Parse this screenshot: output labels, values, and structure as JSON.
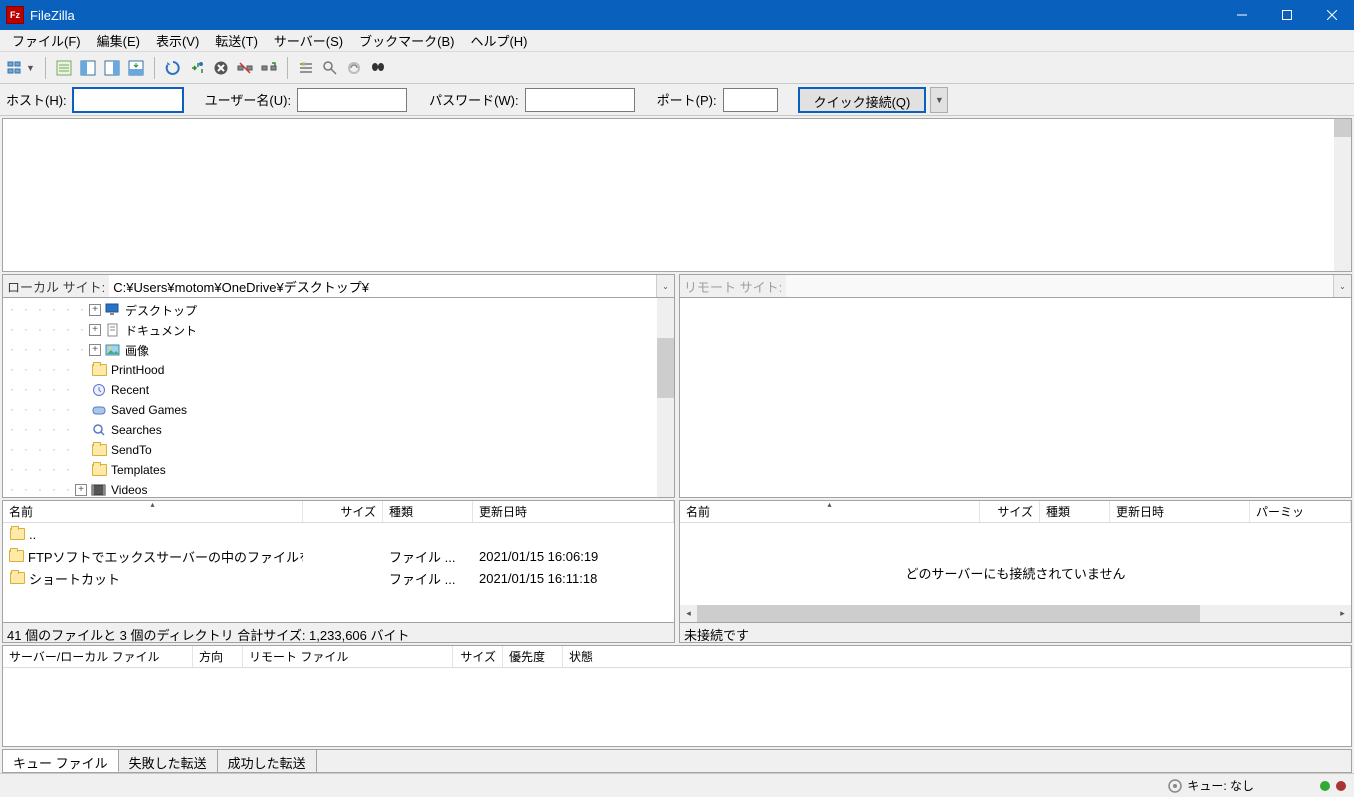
{
  "app": {
    "title": "FileZilla"
  },
  "menu": [
    "ファイル(F)",
    "編集(E)",
    "表示(V)",
    "転送(T)",
    "サーバー(S)",
    "ブックマーク(B)",
    "ヘルプ(H)"
  ],
  "quick": {
    "host_label": "ホスト(H):",
    "user_label": "ユーザー名(U):",
    "pass_label": "パスワード(W):",
    "port_label": "ポート(P):",
    "connect_btn": "クイック接続(Q)",
    "host": "",
    "user": "",
    "pass": "",
    "port": ""
  },
  "local": {
    "site_label": "ローカル サイト:",
    "path": "C:¥Users¥motom¥OneDrive¥デスクトップ¥",
    "tree": [
      {
        "indent": 6,
        "exp": "+",
        "icon": "desktop",
        "label": "デスクトップ"
      },
      {
        "indent": 6,
        "exp": "+",
        "icon": "document",
        "label": "ドキュメント"
      },
      {
        "indent": 6,
        "exp": "+",
        "icon": "picture",
        "label": "画像"
      },
      {
        "indent": 5,
        "exp": "",
        "icon": "folder",
        "label": "PrintHood"
      },
      {
        "indent": 5,
        "exp": "",
        "icon": "recent",
        "label": "Recent"
      },
      {
        "indent": 5,
        "exp": "",
        "icon": "games",
        "label": "Saved Games"
      },
      {
        "indent": 5,
        "exp": "",
        "icon": "search",
        "label": "Searches"
      },
      {
        "indent": 5,
        "exp": "",
        "icon": "folder",
        "label": "SendTo"
      },
      {
        "indent": 5,
        "exp": "",
        "icon": "folder",
        "label": "Templates"
      },
      {
        "indent": 5,
        "exp": "+",
        "icon": "video",
        "label": "Videos"
      }
    ],
    "columns": [
      "名前",
      "サイズ",
      "種類",
      "更新日時"
    ],
    "rows": [
      {
        "name": "..",
        "size": "",
        "type": "",
        "date": ""
      },
      {
        "name": "FTPソフトでエックスサーバーの中のファイルを...",
        "size": "",
        "type": "ファイル ...",
        "date": "2021/01/15 16:06:19"
      },
      {
        "name": "ショートカット",
        "size": "",
        "type": "ファイル ...",
        "date": "2021/01/15 16:11:18"
      }
    ],
    "status": "41 個のファイルと 3 個のディレクトリ 合計サイズ: 1,233,606 バイト"
  },
  "remote": {
    "site_label": "リモート サイト:",
    "path": "",
    "columns": [
      "名前",
      "サイズ",
      "種類",
      "更新日時",
      "パーミッ"
    ],
    "empty": "どのサーバーにも接続されていません",
    "status": "未接続です"
  },
  "queue": {
    "columns": [
      "サーバー/ローカル ファイル",
      "方向",
      "リモート ファイル",
      "サイズ",
      "優先度",
      "状態"
    ],
    "tabs": [
      "キュー ファイル",
      "失敗した転送",
      "成功した転送"
    ]
  },
  "statusbar": {
    "queue_label": "キュー: なし"
  }
}
